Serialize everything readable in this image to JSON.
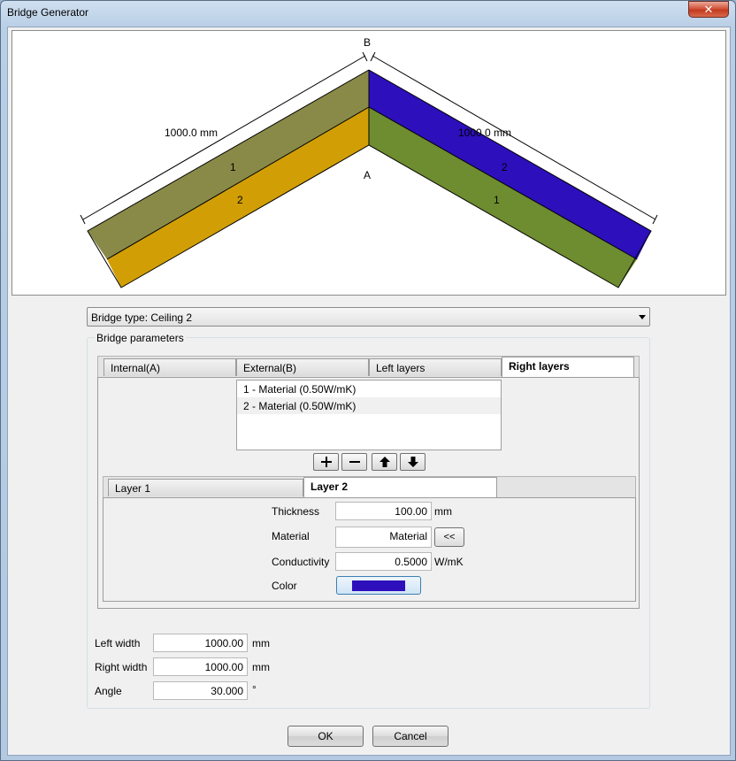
{
  "window": {
    "title": "Bridge Generator",
    "close_glyph": "✕"
  },
  "preview": {
    "label_b": "B",
    "label_a": "A",
    "left_dimension": "1000.0 mm",
    "right_dimension": "1000.0 mm",
    "left_layer_1": "1",
    "left_layer_2": "2",
    "right_layer_2": "2",
    "right_layer_1": "1",
    "colors": {
      "left_layer_1": "#8a8a48",
      "left_layer_2": "#d19f05",
      "right_layer_1": "#6e8c30",
      "right_layer_2": "#2d0fbc"
    }
  },
  "bridge_type": {
    "selected": "Bridge type: Ceiling 2"
  },
  "parameters": {
    "title": "Bridge parameters",
    "tabs": [
      "Internal(A)",
      "External(B)",
      "Left layers",
      "Right layers"
    ],
    "active_tab": "Right layers",
    "layers": [
      "1 - Material (0.50W/mK)",
      "2 - Material (0.50W/mK)"
    ],
    "selected_layer": "2 - Material (0.50W/mK)",
    "list_buttons": {
      "add": "+",
      "remove": "−",
      "up": "up-arrow-icon",
      "down": "down-arrow-icon"
    },
    "layer_tabs": [
      "Layer 1",
      "Layer 2"
    ],
    "active_layer_tab": "Layer 2",
    "thickness_label": "Thickness",
    "thickness_value": "100.00",
    "thickness_unit": "mm",
    "material_label": "Material",
    "material_value": "Material",
    "material_pick": "<<",
    "conductivity_label": "Conductivity",
    "conductivity_value": "0.5000",
    "conductivity_unit": "W/mK",
    "color_label": "Color",
    "color_value": "#2d0fbc"
  },
  "dimensions": {
    "left_width_label": "Left width",
    "left_width_value": "1000.00",
    "left_width_unit": "mm",
    "right_width_label": "Right width",
    "right_width_value": "1000.00",
    "right_width_unit": "mm",
    "angle_label": "Angle",
    "angle_value": "30.000",
    "angle_unit": "°"
  },
  "footer": {
    "ok": "OK",
    "cancel": "Cancel"
  }
}
